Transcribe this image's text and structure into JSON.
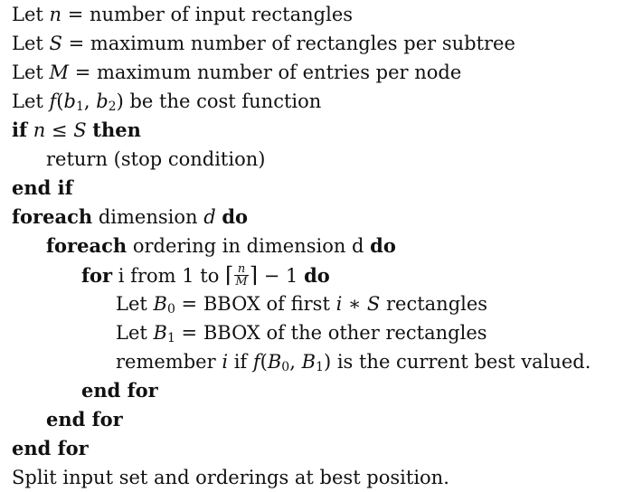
{
  "lines": [
    {
      "let": "Let",
      "var": "n",
      "eq": " = ",
      "text": "number of input rectangles"
    },
    {
      "let": "Let",
      "var": "S",
      "eq": " = ",
      "text": "maximum number of rectangles per subtree"
    },
    {
      "let": "Let",
      "var": "M",
      "eq": " = ",
      "text": "maximum number of entries per node"
    },
    {
      "let": "Let",
      "fn": "f",
      "open": "(",
      "b1": "b",
      "b1sub": "1",
      "comma": ", ",
      "b2": "b",
      "b2sub": "2",
      "close": ")",
      "text": " be the cost function"
    },
    {
      "kw1": "if",
      "v1": "n",
      "op": " ≤ ",
      "v2": "S",
      "kw2": "then"
    },
    {
      "text": "return (stop condition)"
    },
    {
      "kw": "end if"
    },
    {
      "kw1": "foreach",
      "text": " dimension ",
      "var": "d",
      "kw2": "do"
    },
    {
      "kw1": "foreach",
      "text": " ordering in dimension d ",
      "kw2": "do"
    },
    {
      "kw1": "for",
      "text": " i from 1 to ",
      "lceil": "⌈",
      "num": "n",
      "den": "M",
      "rceil": "⌉",
      "tail": " − 1 ",
      "kw2": "do"
    },
    {
      "let": "Let",
      "var": "B",
      "sub": "0",
      "eq": " = ",
      "text": "BBOX of first ",
      "v1": "i",
      "op": " ∗ ",
      "v2": "S",
      "tail": " rectangles"
    },
    {
      "let": "Let",
      "var": "B",
      "sub": "1",
      "eq": " = ",
      "text": "BBOX of the other rectangles"
    },
    {
      "text": "remember ",
      "var": "i",
      "mid": " if ",
      "fn": "f",
      "open": "(",
      "a": "B",
      "asub": "0",
      "comma": ", ",
      "b": "B",
      "bsub": "1",
      "close": ")",
      "tail": " is the current best valued."
    },
    {
      "kw": "end for"
    },
    {
      "kw": "end for"
    },
    {
      "kw": "end for"
    },
    {
      "text": "Split input set and orderings at best position."
    }
  ]
}
